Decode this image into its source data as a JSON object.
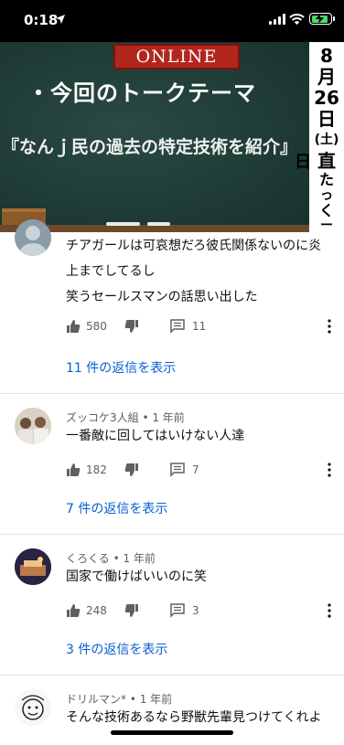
{
  "status_bar": {
    "time": "0:18"
  },
  "video": {
    "sign": "ONLINE",
    "topic": "・今回のトークテーマ",
    "subject": "『なんｊ民の過去の特定技術を紹介』",
    "side_text": [
      "8",
      "月",
      "26",
      "日",
      "(土)",
      "日",
      "直",
      "た",
      "っ",
      "く",
      "ー"
    ]
  },
  "comments": [
    {
      "author_meta": "",
      "lines": [
        "チアガールは可哀想だろ彼氏関係ないのに炎",
        "上までしてるし",
        "笑うセールスマンの話思い出した"
      ],
      "likes": "580",
      "reply_count": "11",
      "view_replies": "11 件の返信を表示"
    },
    {
      "author_meta": "ズッコケ3人組 • 1 年前",
      "lines": [
        "一番敵に回してはいけない人達"
      ],
      "likes": "182",
      "reply_count": "7",
      "view_replies": "7 件の返信を表示"
    },
    {
      "author_meta": "くろくる • 1 年前",
      "lines": [
        "国家で働けばいいのに笑"
      ],
      "likes": "248",
      "reply_count": "3",
      "view_replies": "3 件の返信を表示"
    },
    {
      "author_meta": "ドリルマン* • 1 年前",
      "lines": [
        "そんな技術あるなら野獣先輩見つけてくれよ"
      ],
      "likes": "",
      "reply_count": "",
      "view_replies": ""
    }
  ],
  "icons": {
    "like": "thumb-up-icon",
    "dislike": "thumb-down-icon",
    "reply": "comment-icon",
    "more": "more-vert-icon"
  },
  "colors": {
    "link": "#065fd4",
    "meta": "#606060",
    "battery": "#4cd964"
  }
}
